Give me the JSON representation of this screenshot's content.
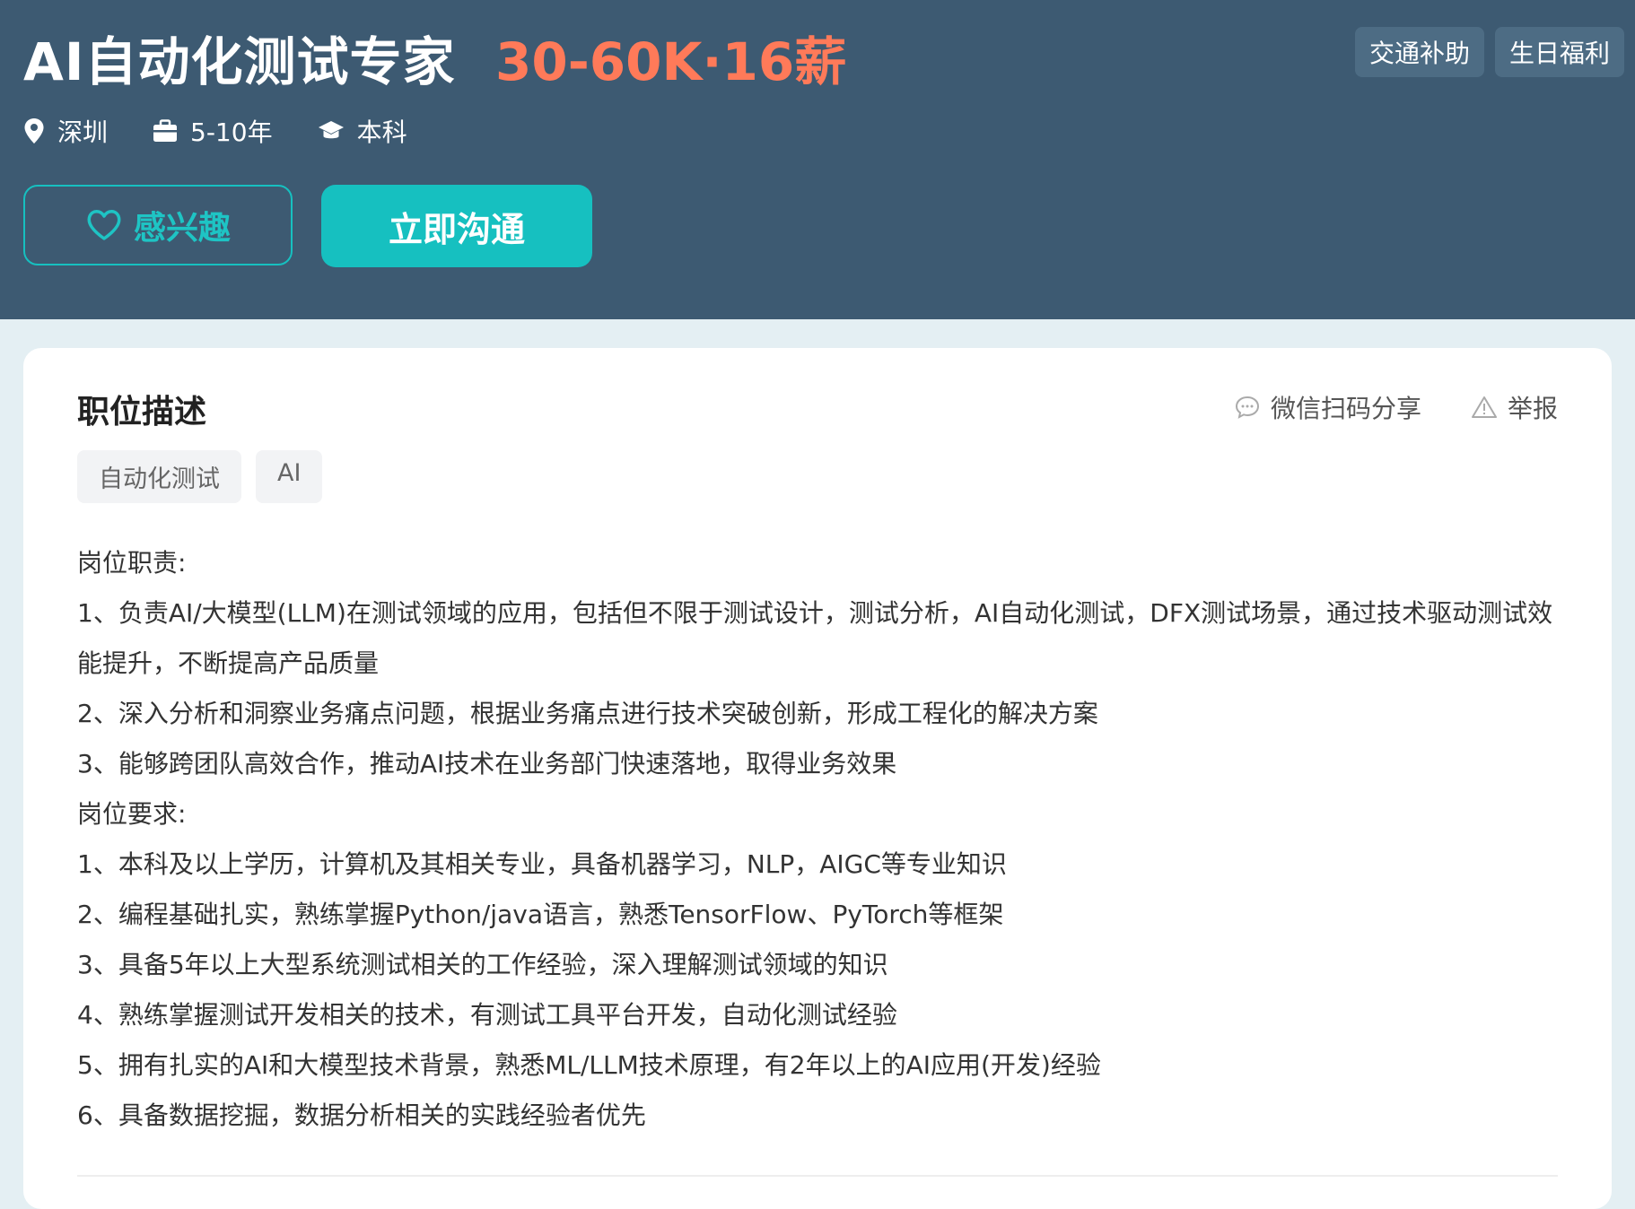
{
  "job": {
    "title": "AI自动化测试专家",
    "salary": "30-60K·16薪",
    "benefits": [
      "交通补助",
      "生日福利"
    ],
    "location": "深圳",
    "experience": "5-10年",
    "education": "本科"
  },
  "actions": {
    "interest_label": "感兴趣",
    "chat_label": "立即沟通"
  },
  "description": {
    "heading": "职位描述",
    "share_label": "微信扫码分享",
    "report_label": "举报",
    "skill_tags": [
      "自动化测试",
      "AI"
    ],
    "lines": [
      "岗位职责:",
      "1、负责AI/大模型(LLM)在测试领域的应用，包括但不限于测试设计，测试分析，AI自动化测试，DFX测试场景，通过技术驱动测试效能提升，不断提高产品质量",
      "2、深入分析和洞察业务痛点问题，根据业务痛点进行技术突破创新，形成工程化的解决方案",
      "3、能够跨团队高效合作，推动AI技术在业务部门快速落地，取得业务效果",
      "岗位要求:",
      "1、本科及以上学历，计算机及其相关专业，具备机器学习，NLP，AIGC等专业知识",
      "2、编程基础扎实，熟练掌握Python/java语言，熟悉TensorFlow、PyTorch等框架",
      "3、具备5年以上大型系统测试相关的工作经验，深入理解测试领域的知识",
      "4、熟练掌握测试开发相关的技术，有测试工具平台开发，自动化测试经验",
      "5、拥有扎实的AI和大模型技术背景，熟悉ML/LLM技术原理，有2年以上的AI应用(开发)经验",
      "6、具备数据挖掘，数据分析相关的实践经验者优先"
    ]
  },
  "colors": {
    "header_bg": "#3d5a72",
    "salary": "#ff7a59",
    "accent": "#16c0c0"
  }
}
